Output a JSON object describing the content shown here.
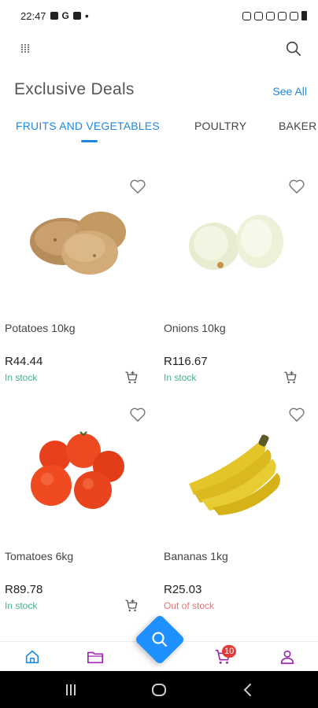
{
  "status_bar": {
    "time": "22:47"
  },
  "header": {
    "title": "Exclusive Deals",
    "see_all": "See All"
  },
  "tabs": [
    {
      "label": "FRUITS AND VEGETABLES",
      "active": true
    },
    {
      "label": "POULTRY",
      "active": false
    },
    {
      "label": "BAKER",
      "active": false
    }
  ],
  "products": [
    {
      "name": "Potatoes 10kg",
      "price": "R44.44",
      "stock": "In stock",
      "image": "potatoes"
    },
    {
      "name": "Onions 10kg",
      "price": "R116.67",
      "stock": "In stock",
      "image": "onions"
    },
    {
      "name": "Tomatoes 6kg",
      "price": "R89.78",
      "stock": "In stock",
      "image": "tomatoes"
    },
    {
      "name": "Bananas 1kg",
      "price": "R25.03",
      "stock": "Out of stock",
      "image": "bananas"
    }
  ],
  "bottom_nav": {
    "cart_count": "10"
  },
  "colors": {
    "accent": "#1e88e5",
    "in_stock": "#4caf8a",
    "out_of_stock": "#e57373",
    "badge": "#e53935",
    "nav_purple": "#9c27b0"
  },
  "icons": [
    "menu-icon",
    "search-icon",
    "heart-icon",
    "add-to-cart-icon",
    "home-icon",
    "folder-icon",
    "cart-icon",
    "user-icon"
  ]
}
